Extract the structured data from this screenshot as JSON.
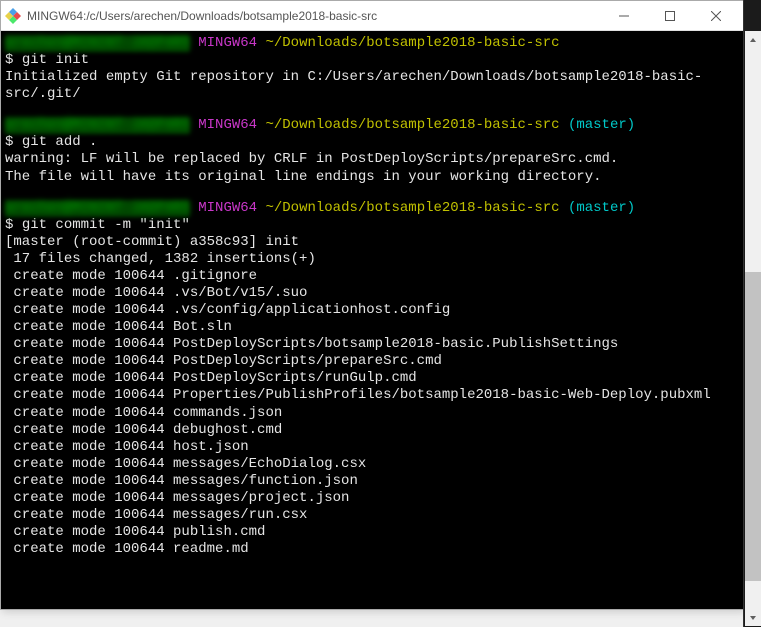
{
  "window": {
    "title": "MINGW64:/c/Users/arechen/Downloads/botsample2018-basic-src"
  },
  "prompts": [
    {
      "user_blurred": "arechen@MININT-JADP4R5",
      "mingw": "MINGW64",
      "path": "~/Downloads/botsample2018-basic-src",
      "branch": "",
      "command": "git init",
      "output": "Initialized empty Git repository in C:/Users/arechen/Downloads/botsample2018-basic-src/.git/"
    },
    {
      "user_blurred": "arechen@MININT-JADP4R5",
      "mingw": "MINGW64",
      "path": "~/Downloads/botsample2018-basic-src",
      "branch": "(master)",
      "command": "git add .",
      "output": "warning: LF will be replaced by CRLF in PostDeployScripts/prepareSrc.cmd.\nThe file will have its original line endings in your working directory."
    },
    {
      "user_blurred": "arechen@MININT-JADP4R5",
      "mingw": "MINGW64",
      "path": "~/Downloads/botsample2018-basic-src",
      "branch": "(master)",
      "command": "git commit -m \"init\"",
      "output": "[master (root-commit) a358c93] init\n 17 files changed, 1382 insertions(+)\n create mode 100644 .gitignore\n create mode 100644 .vs/Bot/v15/.suo\n create mode 100644 .vs/config/applicationhost.config\n create mode 100644 Bot.sln\n create mode 100644 PostDeployScripts/botsample2018-basic.PublishSettings\n create mode 100644 PostDeployScripts/prepareSrc.cmd\n create mode 100644 PostDeployScripts/runGulp.cmd\n create mode 100644 Properties/PublishProfiles/botsample2018-basic-Web-Deploy.pubxml\n create mode 100644 commands.json\n create mode 100644 debughost.cmd\n create mode 100644 host.json\n create mode 100644 messages/EchoDialog.csx\n create mode 100644 messages/function.json\n create mode 100644 messages/project.json\n create mode 100644 messages/run.csx\n create mode 100644 publish.cmd\n create mode 100644 readme.md"
    }
  ]
}
